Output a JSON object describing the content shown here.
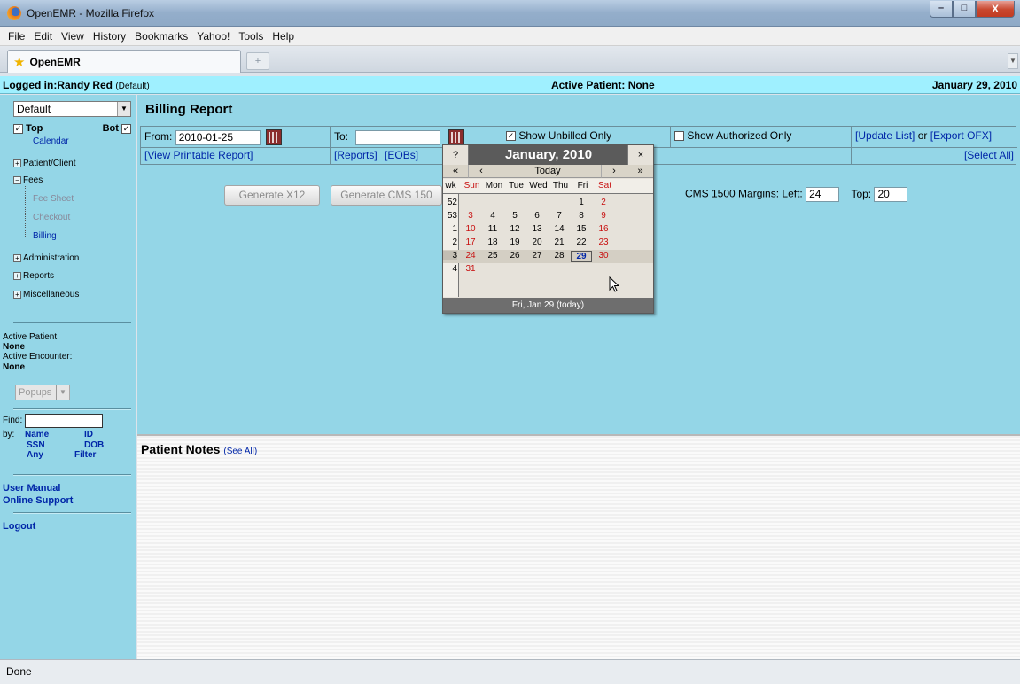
{
  "window": {
    "title": "OpenEMR - Mozilla Firefox",
    "min": "–",
    "max": "□",
    "close": "X"
  },
  "menu": [
    "File",
    "Edit",
    "View",
    "History",
    "Bookmarks",
    "Yahoo!",
    "Tools",
    "Help"
  ],
  "tab": {
    "label": "OpenEMR",
    "new_tab": "+"
  },
  "header": {
    "logged_in": "Logged in:Randy Red",
    "profile": "(Default)",
    "active_patient": "Active Patient: None",
    "date": "January 29, 2010"
  },
  "nav": {
    "layout_select": "Default",
    "top_label": "Top",
    "bot_label": "Bot",
    "items": {
      "calendar": "Calendar",
      "patient_client": "Patient/Client",
      "fees": "Fees",
      "fee_sheet": "Fee Sheet",
      "checkout": "Checkout",
      "billing": "Billing",
      "administration": "Administration",
      "reports": "Reports",
      "miscellaneous": "Miscellaneous"
    },
    "active_patient_label": "Active Patient:",
    "active_patient_value": "None",
    "active_encounter_label": "Active Encounter:",
    "active_encounter_value": "None",
    "popups": "Popups",
    "find_label": "Find:",
    "by_label": "by:",
    "by": {
      "name": "Name",
      "id": "ID",
      "ssn": "SSN",
      "dob": "DOB",
      "any": "Any",
      "filter": "Filter"
    },
    "user_manual": "User Manual",
    "online_support": "Online Support",
    "logout": "Logout"
  },
  "report": {
    "title": "Billing Report",
    "from_label": "From:",
    "from_value": "2010-01-25",
    "to_label": "To:",
    "to_value": "",
    "show_unbilled": "Show Unbilled Only",
    "show_authorized": "Show Authorized Only",
    "update_list": "[Update List]",
    "or": "or",
    "export_ofx": "[Export OFX]",
    "view_printable": "[View Printable Report]",
    "reports_link": "[Reports]",
    "eobs_link": "[EOBs]",
    "select_all": "[Select All]",
    "generate_x12": "Generate X12",
    "generate_cms": "Generate CMS 150",
    "cms_margins": "CMS 1500 Margins:",
    "left_label": "Left:",
    "left_value": "24",
    "top_label": "Top:",
    "top_value": "20"
  },
  "notes": {
    "title": "Patient Notes",
    "see_all": "(See All)"
  },
  "status": "Done",
  "calendar": {
    "help": "?",
    "title": "January, 2010",
    "close": "×",
    "nav": [
      "«",
      "‹",
      "Today",
      "›",
      "»"
    ],
    "day_headers": [
      "wk",
      "Sun",
      "Mon",
      "Tue",
      "Wed",
      "Thu",
      "Fri",
      "Sat"
    ],
    "weeks": [
      {
        "wk": "52",
        "days": [
          "",
          "",
          "",
          "",
          "",
          "1",
          "2"
        ]
      },
      {
        "wk": "53",
        "days": [
          "3",
          "4",
          "5",
          "6",
          "7",
          "8",
          "9"
        ]
      },
      {
        "wk": "1",
        "days": [
          "10",
          "11",
          "12",
          "13",
          "14",
          "15",
          "16"
        ]
      },
      {
        "wk": "2",
        "days": [
          "17",
          "18",
          "19",
          "20",
          "21",
          "22",
          "23"
        ]
      },
      {
        "wk": "3",
        "days": [
          "24",
          "25",
          "26",
          "27",
          "28",
          "29",
          "30"
        ]
      },
      {
        "wk": "4",
        "days": [
          "31",
          "",
          "",
          "",
          "",
          "",
          ""
        ]
      }
    ],
    "footer": "Fri, Jan 29 (today)"
  }
}
